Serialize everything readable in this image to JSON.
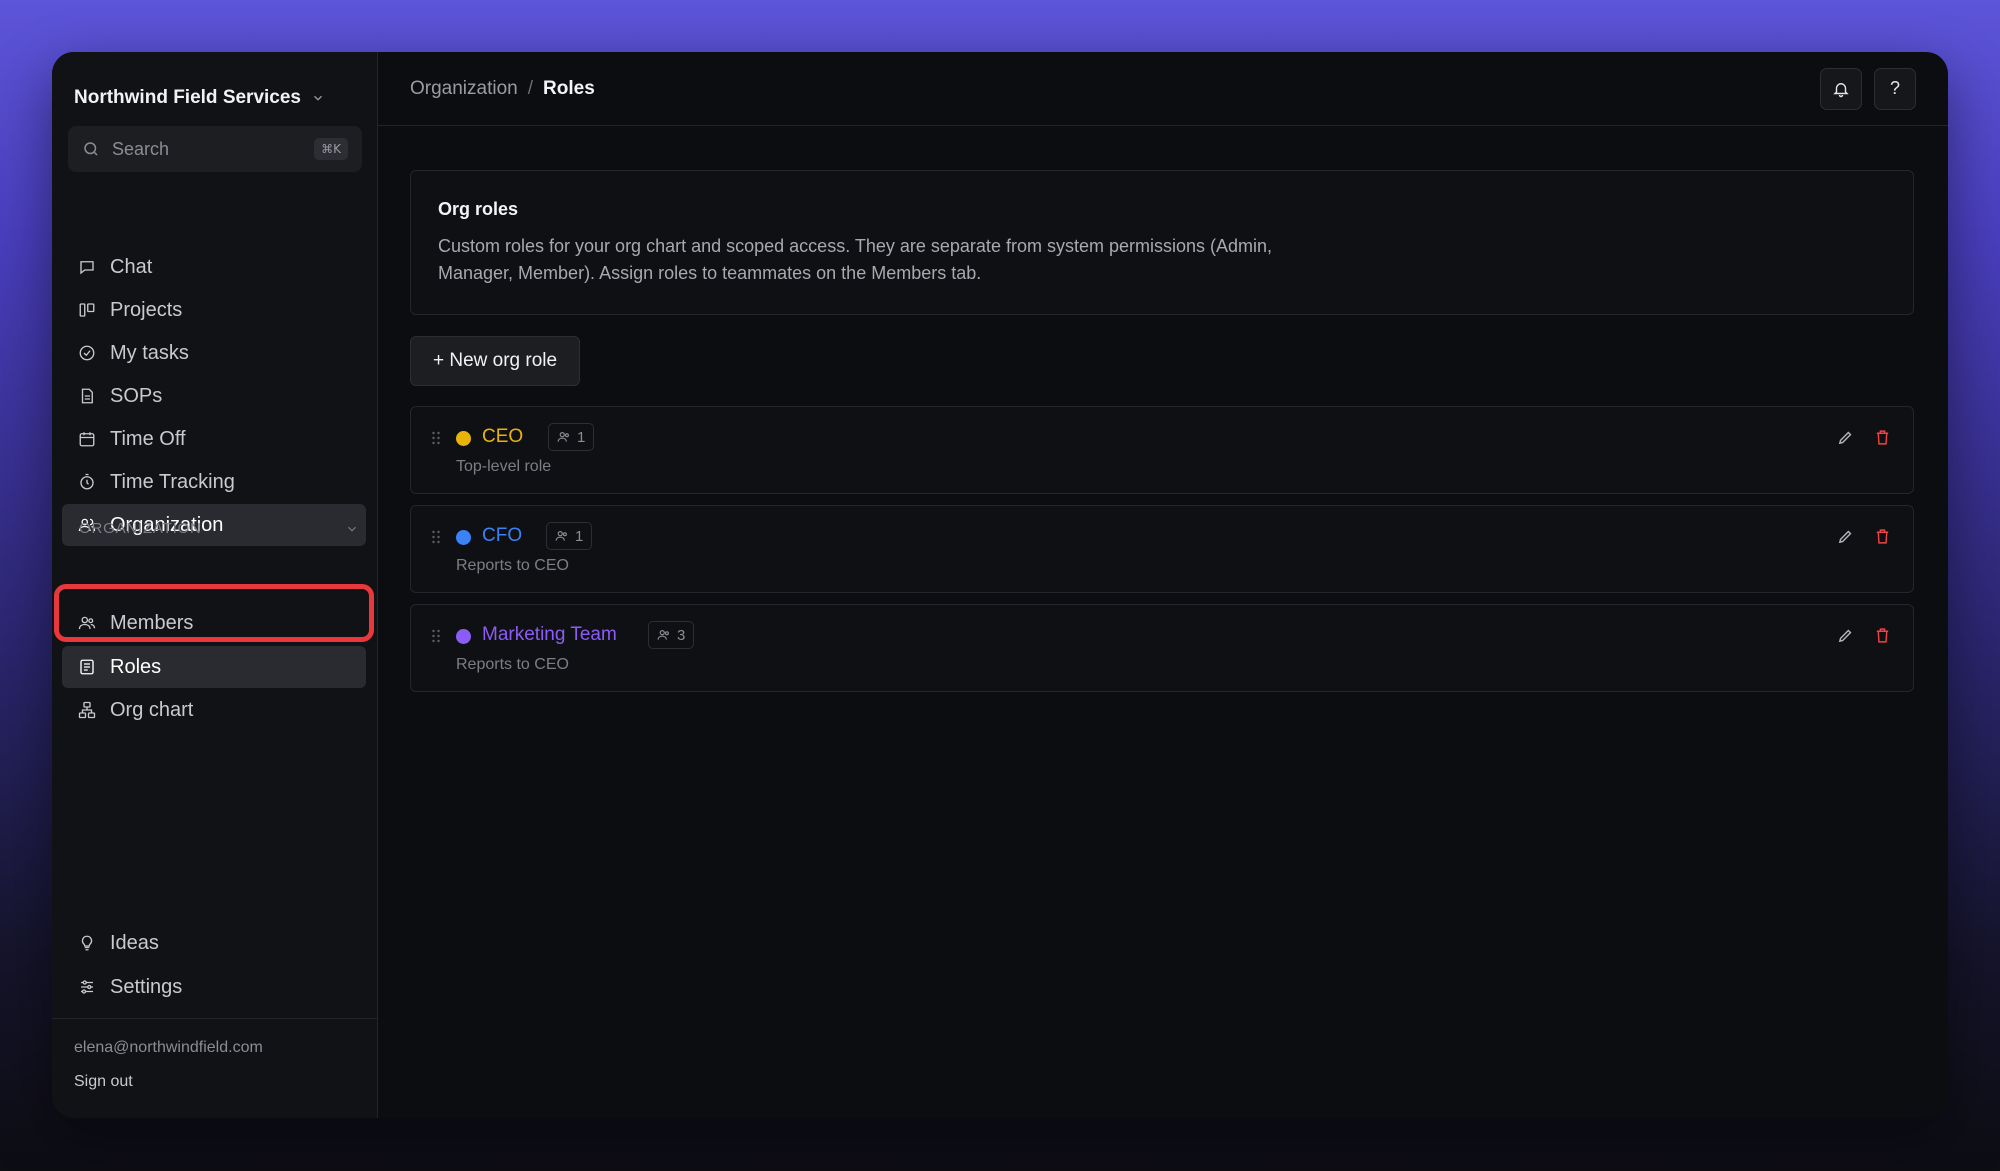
{
  "org": {
    "name": "Northwind Field Services"
  },
  "search": {
    "placeholder": "Search",
    "shortcut": "⌘K"
  },
  "nav": {
    "main": [
      "Chat",
      "Projects",
      "My tasks",
      "SOPs",
      "Time Off",
      "Time Tracking",
      "Organization"
    ],
    "section_label": "ORGANIZATION",
    "org": [
      "Members",
      "Roles",
      "Org chart"
    ],
    "bottom": [
      "Ideas",
      "Settings"
    ]
  },
  "user": {
    "email": "elena@northwindfield.com",
    "signout": "Sign out"
  },
  "breadcrumb": {
    "parent": "Organization",
    "separator": "/",
    "current": "Roles"
  },
  "top_actions": {
    "help": "?"
  },
  "info": {
    "title": "Org roles",
    "description": "Custom roles for your org chart and scoped access. They are separate from system permissions (Admin, Manager, Member). Assign roles to teammates on the Members tab."
  },
  "new_role_button": "+ New org role",
  "roles": [
    {
      "name": "CEO",
      "count": "1",
      "subtitle": "Top-level role",
      "color": "#eab308"
    },
    {
      "name": "CFO",
      "count": "1",
      "subtitle": "Reports to CEO",
      "color": "#3b82f6"
    },
    {
      "name": "Marketing Team",
      "count": "3",
      "subtitle": "Reports to CEO",
      "color": "#8b5cf6"
    }
  ],
  "colors": {
    "accent_active_bg": "#2a2b30",
    "highlight_border": "#e8383d",
    "delete_red": "#ef4444"
  }
}
